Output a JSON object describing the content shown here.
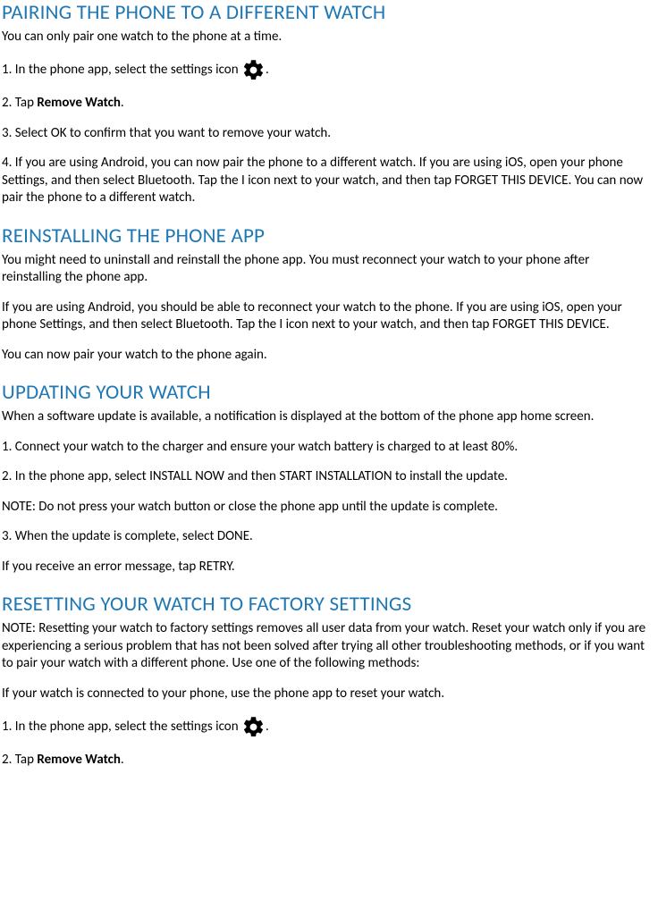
{
  "section1": {
    "heading": "PAIRING THE PHONE TO A DIFFERENT WATCH",
    "intro": "You can only pair one watch to the phone at a time.",
    "step1_pre": "1. In the phone app, select the settings icon  ",
    "step1_post": ".",
    "step2_pre": "2. Tap ",
    "step2_bold": "Remove Watch",
    "step2_post": ".",
    "step3": "3. Select OK to confirm that you want to remove your watch.",
    "step4": "4. If you are using Android, you can now pair the phone to a different watch. If you are using iOS, open your phone Settings, and then select Bluetooth. Tap the I icon next to your watch, and then tap FORGET THIS DEVICE. You can now pair the phone to a different watch."
  },
  "section2": {
    "heading": "REINSTALLING THE PHONE APP",
    "p1": "You might need to uninstall and reinstall the phone app. You must reconnect your watch to your phone after reinstalling the phone app.",
    "p2": "If you are using Android, you should be able to reconnect your watch to the phone. If you are using iOS, open your phone Settings, and then select Bluetooth. Tap the I icon next to your watch, and then tap FORGET THIS DEVICE.",
    "p3": "You can now pair your watch to the phone again."
  },
  "section3": {
    "heading": "UPDATING YOUR WATCH",
    "p1": "When a software update is available, a notification is displayed at the bottom of the phone app home screen.",
    "step1": "1. Connect your watch to the charger and ensure your watch battery is charged to at least 80%.",
    "step2": "2. In the phone app, select INSTALL NOW and then START INSTALLATION to install the update.",
    "note": "NOTE: Do not press your watch button or close the phone app until the update is complete.",
    "step3": "3. When the update is complete, select DONE.",
    "p2": "If you receive an error message, tap RETRY."
  },
  "section4": {
    "heading": "RESETTING YOUR WATCH TO FACTORY SETTINGS",
    "p1": "NOTE: Resetting your watch to factory settings removes all user data from your watch. Reset your watch only if you are experiencing a serious problem that has not been solved after trying all other troubleshooting methods, or if you want to pair your watch with a different phone. Use one of the following methods:",
    "p2": "If your watch is connected to your phone, use the phone app to reset your watch.",
    "step1_pre": "1. In the phone app, select the settings icon  ",
    "step1_post": ".",
    "step2_pre": "2. Tap ",
    "step2_bold": "Remove Watch",
    "step2_post": "."
  }
}
